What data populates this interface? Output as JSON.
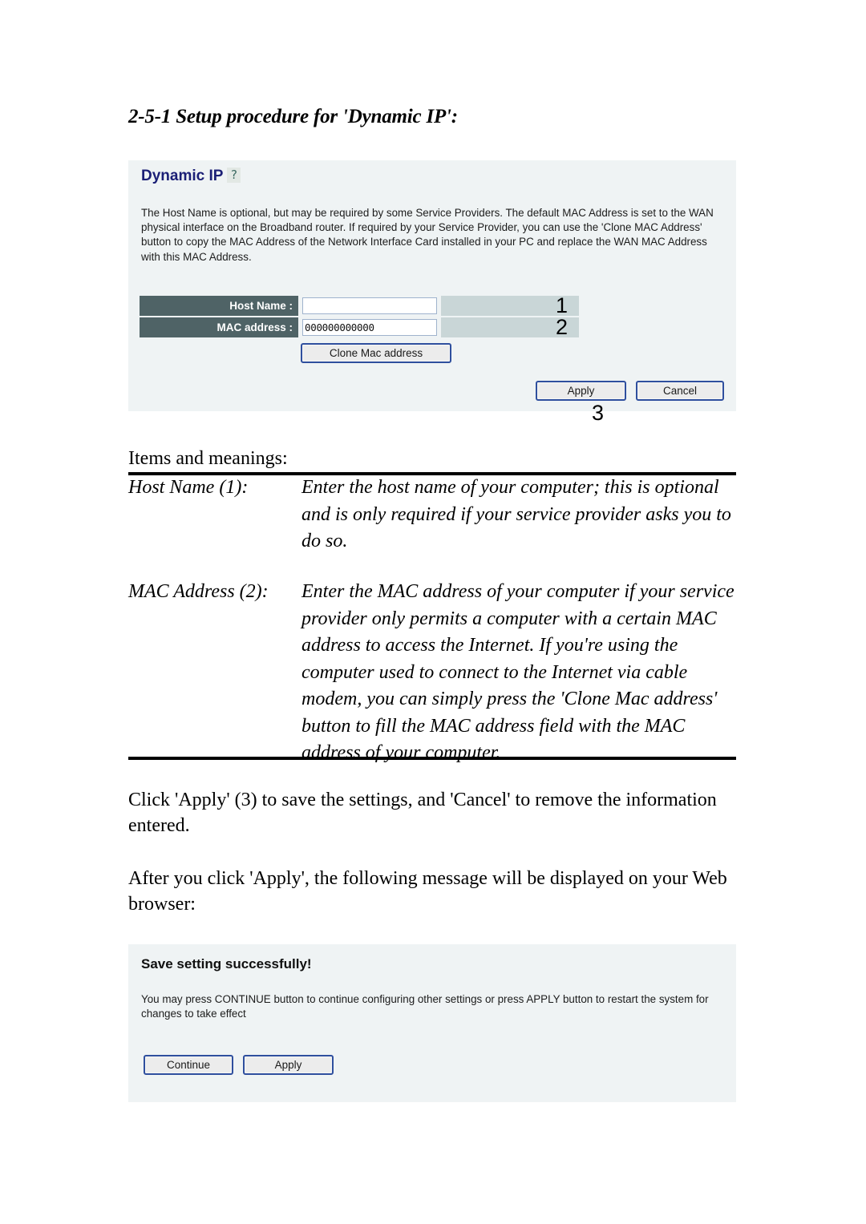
{
  "document": {
    "section_heading": "2-5-1 Setup procedure for 'Dynamic IP':"
  },
  "dynamic_ip_panel": {
    "title": "Dynamic IP",
    "title_icon": "?",
    "description": "The Host Name is optional, but may be required by some Service Providers. The default MAC Address is set to the WAN physical interface on the Broadband router. If required by your Service Provider, you can use the 'Clone MAC Address' button to copy the MAC Address of the Network Interface Card installed in your PC and replace the WAN MAC Address with this MAC Address.",
    "fields": [
      {
        "label": "Host Name :",
        "value": "",
        "annotation": "1"
      },
      {
        "label": "MAC address :",
        "value": "000000000000",
        "annotation": "2"
      }
    ],
    "clone_button": "Clone Mac address",
    "apply_button": "Apply",
    "cancel_button": "Cancel",
    "apply_annotation": "3"
  },
  "items_and_meanings": {
    "heading": "Items and meanings:",
    "rows": [
      {
        "term": "Host Name (1):",
        "definition": "Enter the host name of your computer; this is optional and is only required if your service provider asks you to do so."
      },
      {
        "term": "MAC Address (2):",
        "definition": "Enter the MAC address of your computer if your service provider only permits a computer with a certain MAC address to access the Internet. If you're using the computer used to connect to the Internet via cable modem, you can simply press the 'Clone Mac address' button to fill the MAC address field with the MAC address of your computer."
      }
    ]
  },
  "body": {
    "paragraph_click": "Click 'Apply' (3) to save the settings, and 'Cancel' to remove the information entered.",
    "paragraph_after": "After you click 'Apply', the following message will be displayed on your Web browser:"
  },
  "save_panel": {
    "title": "Save setting successfully!",
    "description": "You may press CONTINUE button to continue configuring other settings or press APPLY button to restart the system for changes to take effect",
    "continue_button": "Continue",
    "apply_button": "Apply"
  },
  "colors": {
    "panel_background": "#eff3f4",
    "field_label_background": "#4f6366",
    "annotation_cell_background": "#c9d6d7",
    "panel_title_text": "#1b1f76",
    "button_border": "#2f4f9e",
    "button_face": "#ececec"
  }
}
